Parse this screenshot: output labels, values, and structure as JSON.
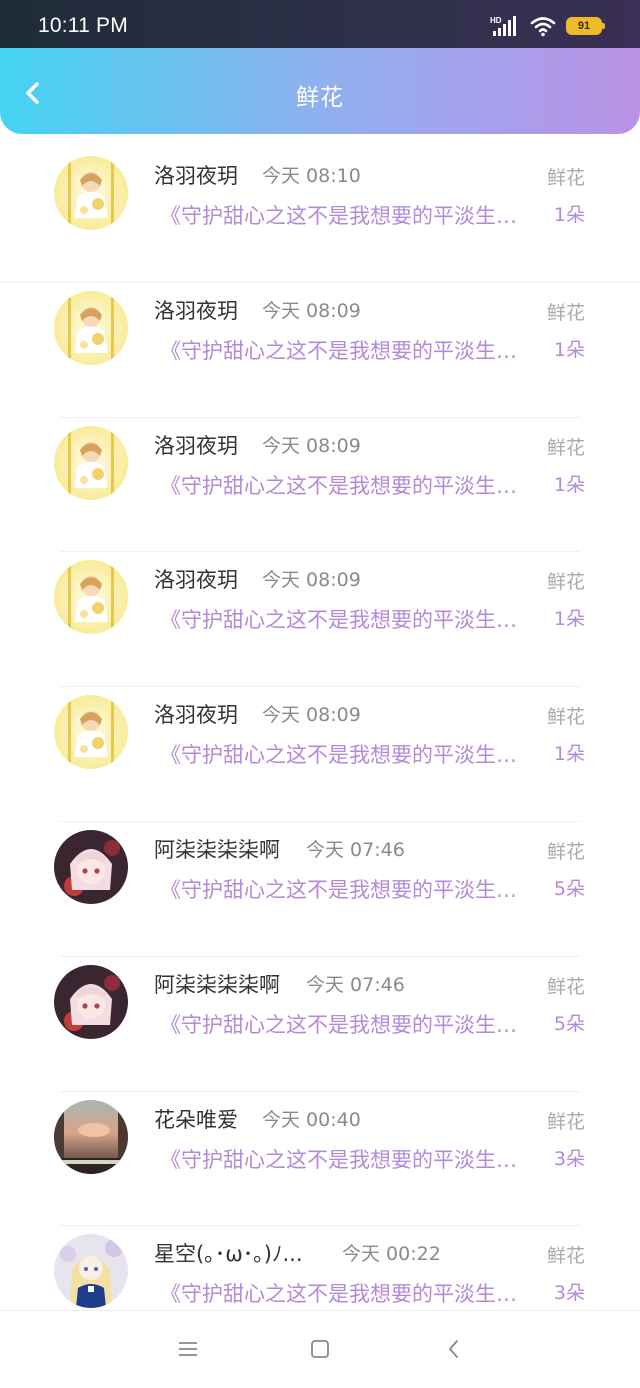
{
  "status_bar": {
    "time": "10:11 PM",
    "network_label": "HD",
    "battery": "91"
  },
  "header": {
    "title": "鲜花",
    "back_icon": "chevron-left-icon"
  },
  "items": [
    {
      "name": "洛羽夜玥",
      "time": "今天 08:10",
      "book": "《守护甜心之这不是我想要的平淡生活》",
      "type": "鲜花",
      "count": "1朵",
      "avatar": "yellow"
    },
    {
      "name": "洛羽夜玥",
      "time": "今天 08:09",
      "book": "《守护甜心之这不是我想要的平淡生活》",
      "type": "鲜花",
      "count": "1朵",
      "avatar": "yellow"
    },
    {
      "name": "洛羽夜玥",
      "time": "今天 08:09",
      "book": "《守护甜心之这不是我想要的平淡生活》",
      "type": "鲜花",
      "count": "1朵",
      "avatar": "yellow"
    },
    {
      "name": "洛羽夜玥",
      "time": "今天 08:09",
      "book": "《守护甜心之这不是我想要的平淡生活》",
      "type": "鲜花",
      "count": "1朵",
      "avatar": "yellow"
    },
    {
      "name": "洛羽夜玥",
      "time": "今天 08:09",
      "book": "《守护甜心之这不是我想要的平淡生活》",
      "type": "鲜花",
      "count": "1朵",
      "avatar": "yellow"
    },
    {
      "name": "阿柒柒柒柒啊",
      "time": "今天 07:46",
      "book": "《守护甜心之这不是我想要的平淡生活》",
      "type": "鲜花",
      "count": "5朵",
      "avatar": "pink"
    },
    {
      "name": "阿柒柒柒柒啊",
      "time": "今天 07:46",
      "book": "《守护甜心之这不是我想要的平淡生活》",
      "type": "鲜花",
      "count": "5朵",
      "avatar": "pink"
    },
    {
      "name": "花朵唯爱",
      "time": "今天 00:40",
      "book": "《守护甜心之这不是我想要的平淡生活》",
      "type": "鲜花",
      "count": "3朵",
      "avatar": "sunset"
    },
    {
      "name": "星空(｡･ω･｡)ﾉ...",
      "time": "今天 00:22",
      "book": "《守护甜心之这不是我想要的平淡生活》",
      "type": "鲜花",
      "count": "3朵",
      "avatar": "blue"
    }
  ],
  "nav_bar": {
    "menu_icon": "menu-icon",
    "home_icon": "home-square-icon",
    "back_icon": "back-triangle-icon"
  },
  "colors": {
    "header_start": "#45d3f2",
    "header_end": "#bb92e6",
    "accent_purple": "#b48ad8",
    "name_text": "#333333",
    "meta_text": "#8a8a8a"
  }
}
